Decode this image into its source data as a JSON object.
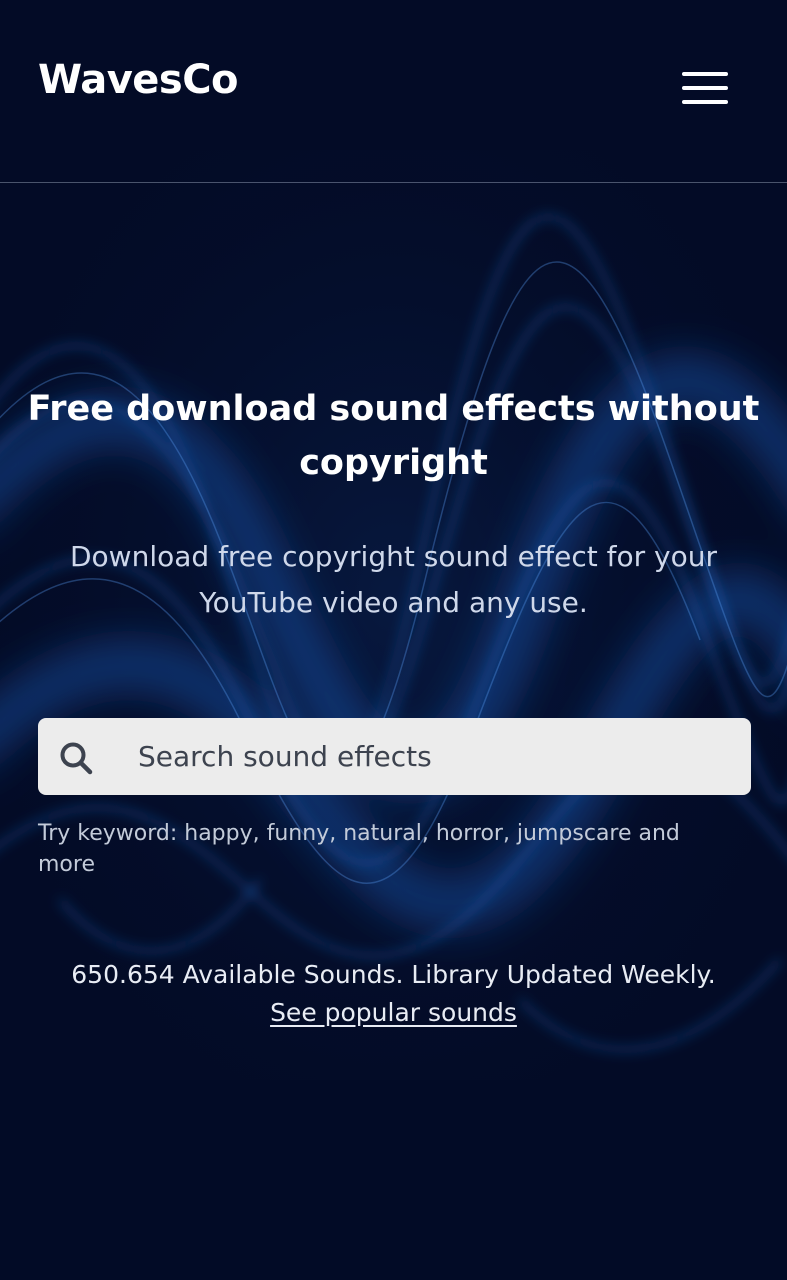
{
  "header": {
    "logo": "WavesCo",
    "menu_icon": "hamburger-menu-icon"
  },
  "hero": {
    "title": "Free download sound effects without copyright",
    "subtitle": "Download free copyright sound effect for your YouTube video and any use."
  },
  "search": {
    "icon": "search-icon",
    "placeholder": "Search sound effects",
    "value": "",
    "hint": "Try keyword: happy, funny, natural, horror, jumpscare and more"
  },
  "stats": {
    "text": "650.654 Available Sounds. Library Updated Weekly.",
    "link_label": "See popular sounds"
  },
  "colors": {
    "background": "#030b26",
    "wave_accent": "#1e6fd9",
    "search_bg": "#ececec",
    "text_primary": "#ffffff",
    "text_muted": "#cfd8ea"
  }
}
